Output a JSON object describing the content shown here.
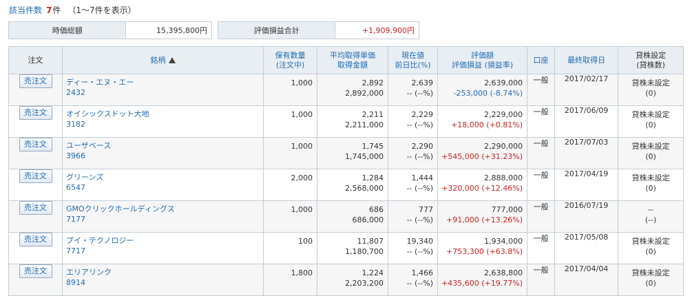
{
  "summary_count": {
    "label": "該当件数",
    "count": "7",
    "unit": "件",
    "range_text": "（1〜7件を表示）"
  },
  "market_value": {
    "label": "時価総額",
    "value": "15,395,800円"
  },
  "unrealized_total": {
    "label": "評価損益合計",
    "value": "+1,909,900円"
  },
  "table": {
    "headers": {
      "order": "注文",
      "name": "銘柄",
      "qty_1": "保有数量",
      "qty_2": "(注文中)",
      "avg_1": "平均取得単価",
      "avg_2": "取得金額",
      "price_1": "現在値",
      "price_2": "前日比(%)",
      "eval_1": "評価額",
      "eval_2": "評価損益 (損益率)",
      "account": "口座",
      "last_date": "最終取得日",
      "lend_1": "貸株設定",
      "lend_2": "(貸株数)"
    },
    "rows": [
      {
        "button": "売注文",
        "name": "ディー・エヌ・エー",
        "code": "2432",
        "qty": "1,000",
        "avg_price": "2,892",
        "cost": "2,892,000",
        "price": "2,639",
        "change": "-- (--%)",
        "eval_value": "2,639,000",
        "pl": "-253,000 (-8.74%)",
        "account": "一般",
        "date": "2017/02/17",
        "lend_setting": "貸株未設定",
        "lend_qty": "(0)"
      },
      {
        "button": "売注文",
        "name": "オイシックスドット大地",
        "code": "3182",
        "qty": "1,000",
        "avg_price": "2,211",
        "cost": "2,211,000",
        "price": "2,229",
        "change": "-- (--%)",
        "eval_value": "2,229,000",
        "pl": "+18,000 (+0.81%)",
        "account": "一般",
        "date": "2017/06/09",
        "lend_setting": "貸株未設定",
        "lend_qty": "(0)"
      },
      {
        "button": "売注文",
        "name": "ユーザベース",
        "code": "3966",
        "qty": "1,000",
        "avg_price": "1,745",
        "cost": "1,745,000",
        "price": "2,290",
        "change": "-- (--%)",
        "eval_value": "2,290,000",
        "pl": "+545,000 (+31.23%)",
        "account": "一般",
        "date": "2017/07/03",
        "lend_setting": "貸株未設定",
        "lend_qty": "(0)"
      },
      {
        "button": "売注文",
        "name": "グリーンズ",
        "code": "6547",
        "qty": "2,000",
        "avg_price": "1,284",
        "cost": "2,568,000",
        "price": "1,444",
        "change": "-- (--%)",
        "eval_value": "2,888,000",
        "pl": "+320,000 (+12.46%)",
        "account": "一般",
        "date": "2017/04/19",
        "lend_setting": "貸株未設定",
        "lend_qty": "(0)"
      },
      {
        "button": "売注文",
        "name": "GMOクリックホールディングス",
        "code": "7177",
        "qty": "1,000",
        "avg_price": "686",
        "cost": "686,000",
        "price": "777",
        "change": "-- (--%)",
        "eval_value": "777,000",
        "pl": "+91,000 (+13.26%)",
        "account": "一般",
        "date": "2016/07/19",
        "lend_setting": "--",
        "lend_qty": "(--)"
      },
      {
        "button": "売注文",
        "name": "ブイ・テクノロジー",
        "code": "7717",
        "qty": "100",
        "avg_price": "11,807",
        "cost": "1,180,700",
        "price": "19,340",
        "change": "-- (--%)",
        "eval_value": "1,934,000",
        "pl": "+753,300 (+63.8%)",
        "account": "一般",
        "date": "2017/05/08",
        "lend_setting": "貸株未設定",
        "lend_qty": "(0)"
      },
      {
        "button": "売注文",
        "name": "エリアリンク",
        "code": "8914",
        "qty": "1,800",
        "avg_price": "1,224",
        "cost": "2,203,200",
        "price": "1,466",
        "change": "-- (--%)",
        "eval_value": "2,638,800",
        "pl": "+435,600 (+19.77%)",
        "account": "一般",
        "date": "2017/04/04",
        "lend_setting": "貸株未設定",
        "lend_qty": "(0)"
      }
    ]
  },
  "colors": {
    "link": "#1f6cb3",
    "positive": "#d02020",
    "negative": "#1f6cb3",
    "header_bg": "#e9eef3",
    "border": "#c3cdd7"
  },
  "icons": {
    "sort": "sort-ascending-triangle-icon"
  }
}
